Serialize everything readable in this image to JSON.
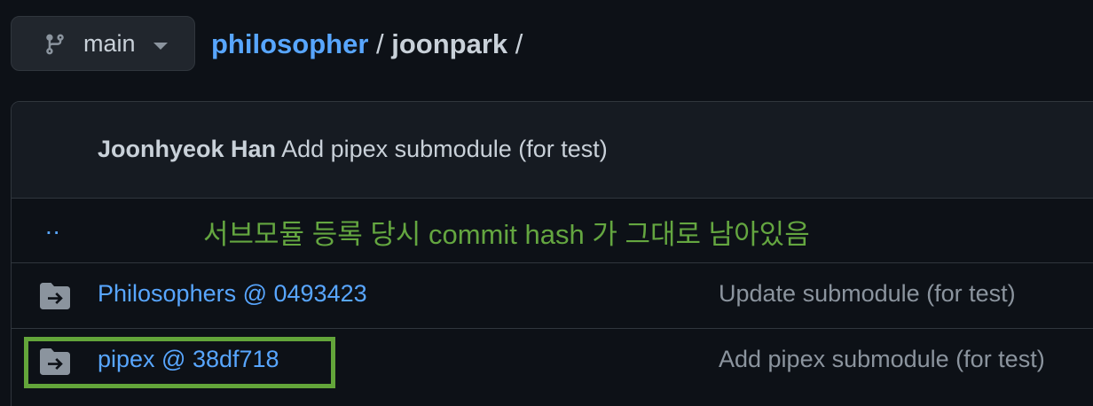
{
  "branch": {
    "name": "main",
    "icon": "git-branch-icon"
  },
  "breadcrumb": {
    "repo": "philosopher",
    "separator1": " / ",
    "directory": "joonpark",
    "separator2": " /"
  },
  "latest_commit": {
    "author": "Joonhyeok Han",
    "message": "Add pipex submodule (for test)"
  },
  "parent_link": {
    "label": ".."
  },
  "annotation": {
    "text": "서브모듈 등록 당시 commit hash 가 그대로 남아있음",
    "color": "#64a640"
  },
  "files": [
    {
      "name": "Philosophers @ 0493423",
      "message": "Update submodule (for test)",
      "icon": "submodule-folder-icon"
    },
    {
      "name": "pipex @ 38df718",
      "message": "Add pipex submodule (for test)",
      "icon": "submodule-folder-icon"
    }
  ],
  "highlight": {
    "color": "#63a53a",
    "target": "pipex @ 38df718"
  },
  "colors": {
    "background": "#0d1117",
    "link": "#58a6ff",
    "muted": "#8b949e",
    "border": "#30363d"
  }
}
